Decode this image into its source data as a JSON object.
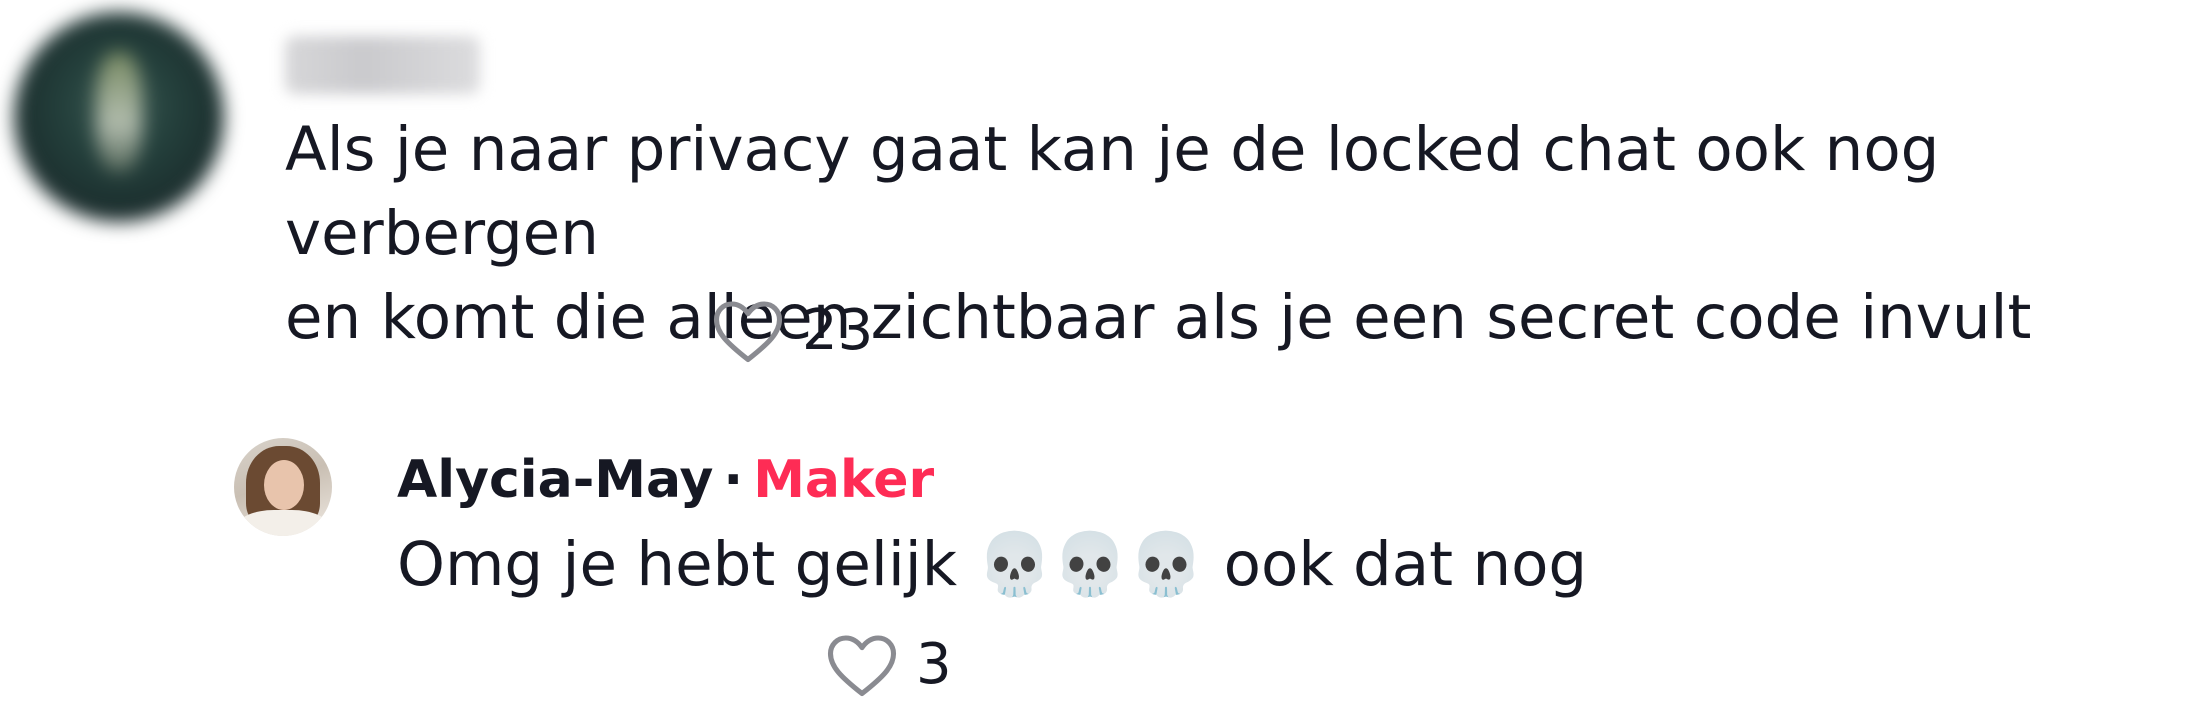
{
  "comment": {
    "username": "",
    "text": "Als je naar privacy gaat kan je de locked chat ook nog verbergen\nen komt die alleen zichtbaar als je een secret code invult",
    "likes": "23",
    "like_icon": "heart-outline-icon"
  },
  "reply": {
    "author": "Alycia-May",
    "separator": "·",
    "badge": "Maker",
    "text": "Omg je hebt gelijk 💀💀💀 ook dat nog",
    "likes": "3",
    "like_icon": "heart-outline-icon"
  },
  "colors": {
    "text": "#161823",
    "badge": "#fe2c55",
    "icon": "#8a8b91"
  }
}
